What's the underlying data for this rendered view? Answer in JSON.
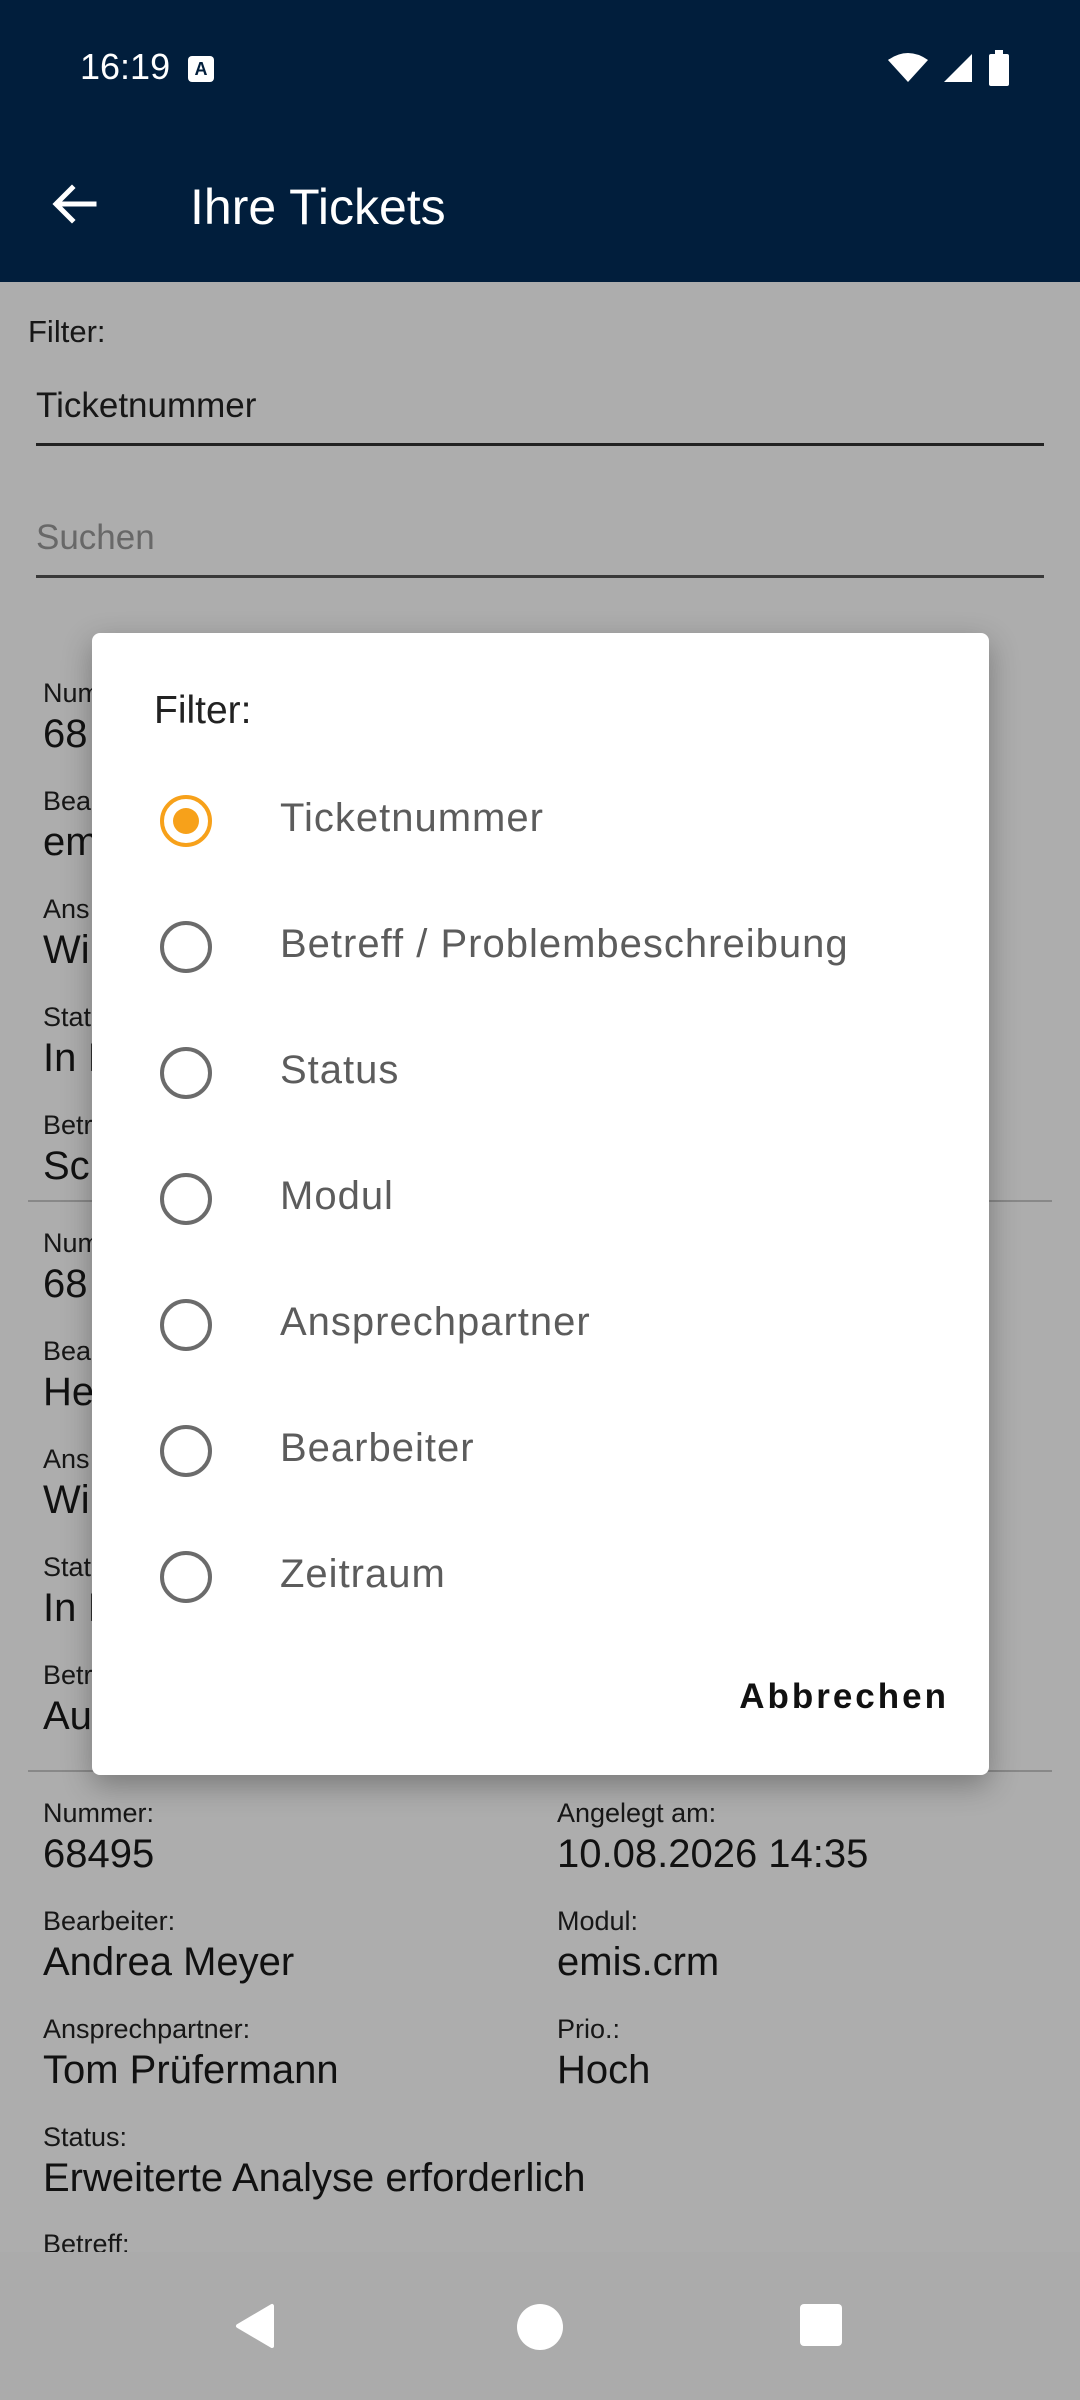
{
  "status_bar": {
    "time": "16:19"
  },
  "app_bar": {
    "title": "Ihre Tickets"
  },
  "filter": {
    "label": "Filter:",
    "selected": "Ticketnummer",
    "search_placeholder": "Suchen"
  },
  "tickets": [
    {
      "nummer_label": "Num",
      "nummer_value": "68",
      "bearbeiter_label": "Bea",
      "bearbeiter_value": "em",
      "ansprech_label": "Ans",
      "ansprech_value": "Wi",
      "status_label": "Stat",
      "status_value": "In I",
      "betreff_label": "Betr",
      "betreff_value": "Sc"
    },
    {
      "nummer_label": "Num",
      "nummer_value": "68",
      "bearbeiter_label": "Bea",
      "bearbeiter_value": "He",
      "ansprech_label": "Ans",
      "ansprech_value": "Wi",
      "status_label": "Stat",
      "status_value": "In I",
      "betreff_label": "Betr",
      "betreff_value": "Au"
    },
    {
      "nummer_label": "Nummer:",
      "nummer_value": "68495",
      "angelegt_label": "Angelegt am:",
      "angelegt_value": "10.08.2026 14:35",
      "bearbeiter_label": "Bearbeiter:",
      "bearbeiter_value": "Andrea Meyer",
      "modul_label": "Modul:",
      "modul_value": "emis.crm",
      "ansprech_label": "Ansprechpartner:",
      "ansprech_value": "Tom Prüfermann",
      "prio_label": "Prio.:",
      "prio_value": "Hoch",
      "status_label": "Status:",
      "status_value": "Erweiterte Analyse erforderlich",
      "betreff_label": "Betreff:"
    }
  ],
  "dialog": {
    "title": "Filter:",
    "options": [
      {
        "label": "Ticketnummer",
        "checked": true
      },
      {
        "label": "Betreff / Problembeschreibung",
        "checked": false
      },
      {
        "label": "Status",
        "checked": false
      },
      {
        "label": "Modul",
        "checked": false
      },
      {
        "label": "Ansprechpartner",
        "checked": false
      },
      {
        "label": "Bearbeiter",
        "checked": false
      },
      {
        "label": "Zeitraum",
        "checked": false
      }
    ],
    "cancel_label": "Abbrechen"
  },
  "colors": {
    "primary": "#011e3c",
    "accent": "#f7a11a",
    "scrim": "rgba(0,0,0,0.32)"
  }
}
